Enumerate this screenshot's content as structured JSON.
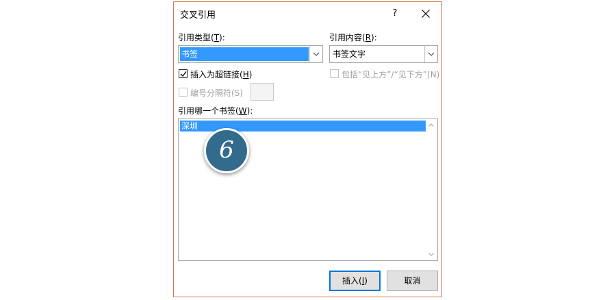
{
  "dialog": {
    "title": "交叉引用",
    "help_label": "?",
    "close_icon": "close-icon"
  },
  "ref_type": {
    "label_prefix": "引用类型(",
    "label_key": "T",
    "label_suffix": "):",
    "value": "书签"
  },
  "ref_content": {
    "label_prefix": "引用内容(",
    "label_key": "R",
    "label_suffix": "):",
    "value": "书签文字"
  },
  "options": {
    "insert_hyperlink_prefix": "插入为超链接(",
    "insert_hyperlink_key": "H",
    "insert_hyperlink_suffix": ")",
    "insert_hyperlink_checked": true,
    "include_above_below": "包括“见上方”/“见下方”(N)",
    "include_above_below_checked": false,
    "separate_numbers": "编号分隔符(S)",
    "separate_numbers_checked": false
  },
  "bookmark_list": {
    "label_prefix": "引用哪一个书签(",
    "label_key": "W",
    "label_suffix": "):",
    "items": [
      "深圳"
    ],
    "selected_index": 0
  },
  "buttons": {
    "insert_prefix": "插入(",
    "insert_key": "I",
    "insert_suffix": ")",
    "cancel": "取消"
  },
  "badge": {
    "number": "6",
    "color": "#336b8c"
  },
  "colors": {
    "selection": "#3399ff",
    "dialog_border": "#d9774e",
    "default_button_border": "#0078d7"
  }
}
